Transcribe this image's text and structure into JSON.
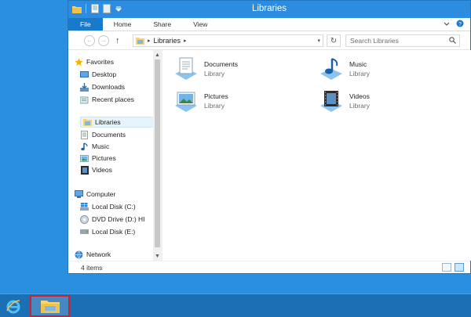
{
  "window": {
    "title": "Libraries"
  },
  "ribbon": {
    "tabs": [
      "File",
      "Home",
      "Share",
      "View"
    ]
  },
  "address": {
    "path": "Libraries",
    "search_placeholder": "Search Libraries"
  },
  "navigation": {
    "favorites": {
      "label": "Favorites",
      "items": [
        "Desktop",
        "Downloads",
        "Recent places"
      ]
    },
    "libraries": {
      "label": "Libraries",
      "items": [
        "Documents",
        "Music",
        "Pictures",
        "Videos"
      ]
    },
    "computer": {
      "label": "Computer",
      "items": [
        "Local Disk (C:)",
        "DVD Drive (D:) HI",
        "Local Disk (E:)"
      ]
    },
    "network": {
      "label": "Network"
    }
  },
  "content": {
    "libraries": [
      {
        "name": "Documents",
        "type": "Library",
        "icon": "documents-library-icon"
      },
      {
        "name": "Music",
        "type": "Library",
        "icon": "music-library-icon"
      },
      {
        "name": "Pictures",
        "type": "Library",
        "icon": "pictures-library-icon"
      },
      {
        "name": "Videos",
        "type": "Library",
        "icon": "videos-library-icon"
      }
    ]
  },
  "status": {
    "item_count": "4 items"
  },
  "colors": {
    "desktop": "#2a8fde",
    "title_bar": "#2b8ce0",
    "file_tab": "#1979ca",
    "taskbar": "#1c6fb5",
    "taskbar_highlight": "#d41e2a"
  }
}
